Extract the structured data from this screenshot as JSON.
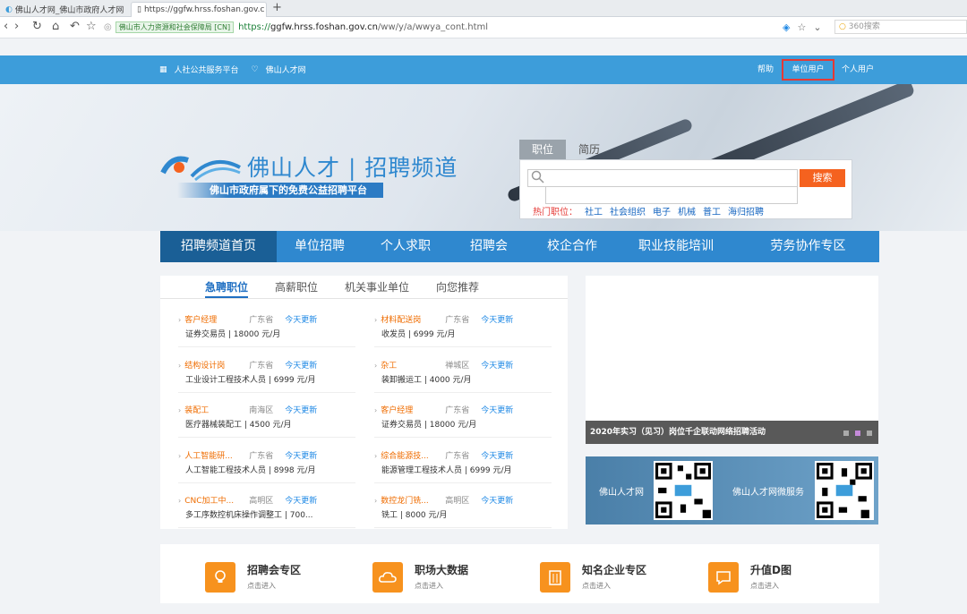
{
  "browser": {
    "tabs": [
      {
        "label": "佛山人才网_佛山市政府人才网",
        "close": "×"
      },
      {
        "label": "https://ggfw.hrss.foshan.gov.c",
        "close": "×"
      }
    ],
    "new_tab": "+",
    "secure_badge": "佛山市人力资源和社会保障局 [CN]",
    "url_scheme": "https://",
    "url_domain": "ggfw.hrss.foshan.gov.cn",
    "url_path": "/ww/y/a/wwya_cont.html",
    "search_engine": "360搜索"
  },
  "topbar": {
    "left_items": [
      "人社公共服务平台",
      "佛山人才网"
    ],
    "help": "帮助",
    "unit_user": "单位用户",
    "person_user": "个人用户"
  },
  "banner": {
    "logo_text": "佛山人才 | 招聘频道",
    "slogan": "佛山市政府属下的免费公益招聘平台",
    "search_tabs": [
      "职位",
      "简历"
    ],
    "search_placeholder": "",
    "search_button": "搜索",
    "hot_label": "热门职位：",
    "hot_items": [
      "社工",
      "社会组织",
      "电子",
      "机械",
      "普工",
      "海归招聘"
    ]
  },
  "nav": [
    "招聘频道首页",
    "单位招聘",
    "个人求职",
    "招聘会",
    "校企合作",
    "职业技能培训",
    "劳务协作专区"
  ],
  "job_tabs": [
    "急聘职位",
    "高薪职位",
    "机关事业单位",
    "向您推荐"
  ],
  "jobs": [
    {
      "title": "客户经理",
      "area": "广东省",
      "update": "今天更新",
      "detail": "证券交易员 | 18000 元/月"
    },
    {
      "title": "材料配送岗",
      "area": "广东省",
      "update": "今天更新",
      "detail": "收发员 | 6999 元/月"
    },
    {
      "title": "结构设计岗",
      "area": "广东省",
      "update": "今天更新",
      "detail": "工业设计工程技术人员 | 6999 元/月"
    },
    {
      "title": "杂工",
      "area": "禅城区",
      "update": "今天更新",
      "detail": "装卸搬运工 | 4000 元/月"
    },
    {
      "title": "装配工",
      "area": "南海区",
      "update": "今天更新",
      "detail": "医疗器械装配工 | 4500 元/月"
    },
    {
      "title": "客户经理",
      "area": "广东省",
      "update": "今天更新",
      "detail": "证券交易员 | 18000 元/月"
    },
    {
      "title": "人工智能研...",
      "area": "广东省",
      "update": "今天更新",
      "detail": "人工智能工程技术人员 | 8998 元/月"
    },
    {
      "title": "综合能源技...",
      "area": "广东省",
      "update": "今天更新",
      "detail": "能源管理工程技术人员 | 6999 元/月"
    },
    {
      "title": "CNC加工中...",
      "area": "高明区",
      "update": "今天更新",
      "detail": "多工序数控机床操作调整工 | 700..."
    },
    {
      "title": "数控龙门铣...",
      "area": "高明区",
      "update": "今天更新",
      "detail": "铣工 | 8000 元/月"
    }
  ],
  "slider": {
    "caption": "2020年实习（见习）岗位千企联动网络招聘活动"
  },
  "qr": {
    "left_label": "佛山人才网",
    "right_label": "佛山人才网微服务"
  },
  "features": [
    {
      "title": "招聘会专区",
      "sub": "点击进入"
    },
    {
      "title": "职场大数据",
      "sub": "点击进入"
    },
    {
      "title": "知名企业专区",
      "sub": "点击进入"
    },
    {
      "title": "升值D图",
      "sub": "点击进入"
    }
  ],
  "colors": {
    "brand_blue": "#2f88cf",
    "topbar": "#3d9dda",
    "orange": "#f5621f",
    "highlight_box": "#e53935"
  }
}
